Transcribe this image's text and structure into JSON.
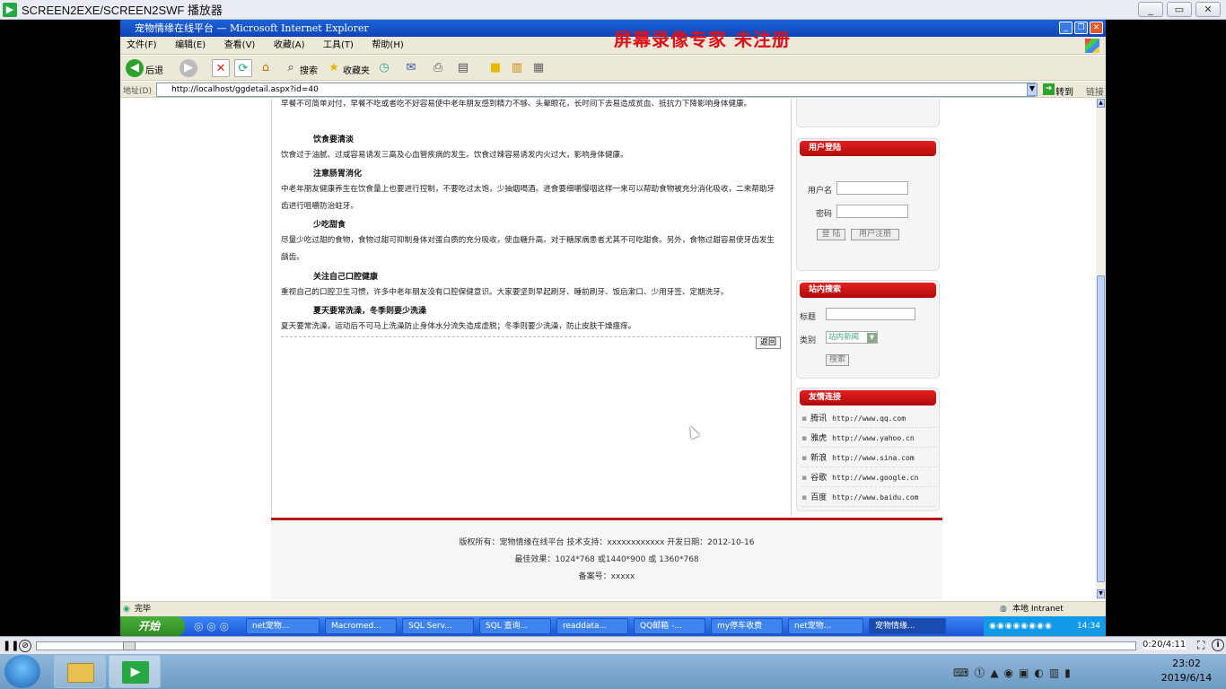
{
  "player": {
    "title": "SCREEN2EXE/SCREEN2SWF 播放器",
    "time": "0:20/4:11"
  },
  "watermark": "屏幕录像专家  未注册",
  "ie": {
    "title": "宠物情缘在线平台 — Microsoft Internet Explorer",
    "menu": [
      "文件(F)",
      "编辑(E)",
      "查看(V)",
      "收藏(A)",
      "工具(T)",
      "帮助(H)"
    ],
    "toolbar": {
      "back": "后退",
      "search": "搜索",
      "favorites": "收藏夹"
    },
    "address_label": "地址(D)",
    "address_value": "http://localhost/ggdetail.aspx?id=40",
    "go": "转到",
    "links": "链接",
    "status_left": "完毕",
    "status_right": "本地 Intranet"
  },
  "article": {
    "p0": "早餐不可简单对付，早餐不吃或者吃不好容易使中老年朋友感到精力不够、头晕眼花，长时间下去易造成贫血、抵抗力下降影响身体健康。",
    "h1": "饮食要清淡",
    "p1": "饮食过于油腻、过咸容易诱发三高及心血管疾病的发生。饮食过辣容易诱发内火过大，影响身体健康。",
    "h2": "注意肠胃消化",
    "p2": "中老年朋友健康养生在饮食量上也要进行控制，不要吃过太饱，少抽烟喝酒。进食要细嚼慢咽这样一来可以帮助食物被充分消化吸收，二来帮助牙齿进行咀嚼防治蛀牙。",
    "h3": "少吃甜食",
    "p3": "尽量少吃过甜的食物，食物过甜可抑制身体对蛋白质的充分吸收，使血糖升高。对于糖尿病患者尤其不可吃甜食。另外，食物过甜容易使牙齿发生龋齿。",
    "h4": "关注自己口腔健康",
    "p4": "重视自己的口腔卫生习惯，许多中老年朋友没有口腔保健意识。大家要坚到早起刷牙、睡前刷牙、饭后漱口、少用牙签、定期洗牙。",
    "h5": "夏天要常洗澡，冬季则要少洗澡",
    "p5": "夏天要常洗澡，运动后不可马上洗澡防止身体水分流失造成虚脱；冬季则要少洗澡，防止皮肤干燥瘙痒。",
    "back_button": "返回"
  },
  "login": {
    "header": "用户登陆",
    "username_label": "用户名",
    "password_label": "密码",
    "login_button": "登 陆",
    "register_button": "用户注册"
  },
  "site_search": {
    "header": "站内搜索",
    "title_label": "标题",
    "category_label": "类别",
    "category_value": "站内新闻",
    "search_button": "搜索"
  },
  "friend_links": {
    "header": "友情连接",
    "items": [
      {
        "name": "腾讯",
        "url": "http://www.qq.com"
      },
      {
        "name": "雅虎",
        "url": "http://www.yahoo.cn"
      },
      {
        "name": "新浪",
        "url": "http://www.sina.com"
      },
      {
        "name": "谷歌",
        "url": "http://www.google.cn"
      },
      {
        "name": "百度",
        "url": "http://www.baidu.com"
      }
    ]
  },
  "footer": {
    "line1": "版权所有：宠物情缘在线平台  技术支持：xxxxxxxxxxxx  开发日期：2012-10-16",
    "line2": "最佳效果：1024*768 或1440*900 或 1360*768",
    "line3": "备案号：xxxxx"
  },
  "xp_taskbar": {
    "start": "开始",
    "tasks": [
      "net宠物...",
      "Macromed...",
      "SQL Serv...",
      "SQL 查询...",
      "readdata...",
      "QQ邮箱 -...",
      "my停车收费",
      "net宠物...",
      "宠物情缘..."
    ],
    "clock": "14:34"
  },
  "win7": {
    "time": "23:02",
    "date": "2019/6/14"
  }
}
